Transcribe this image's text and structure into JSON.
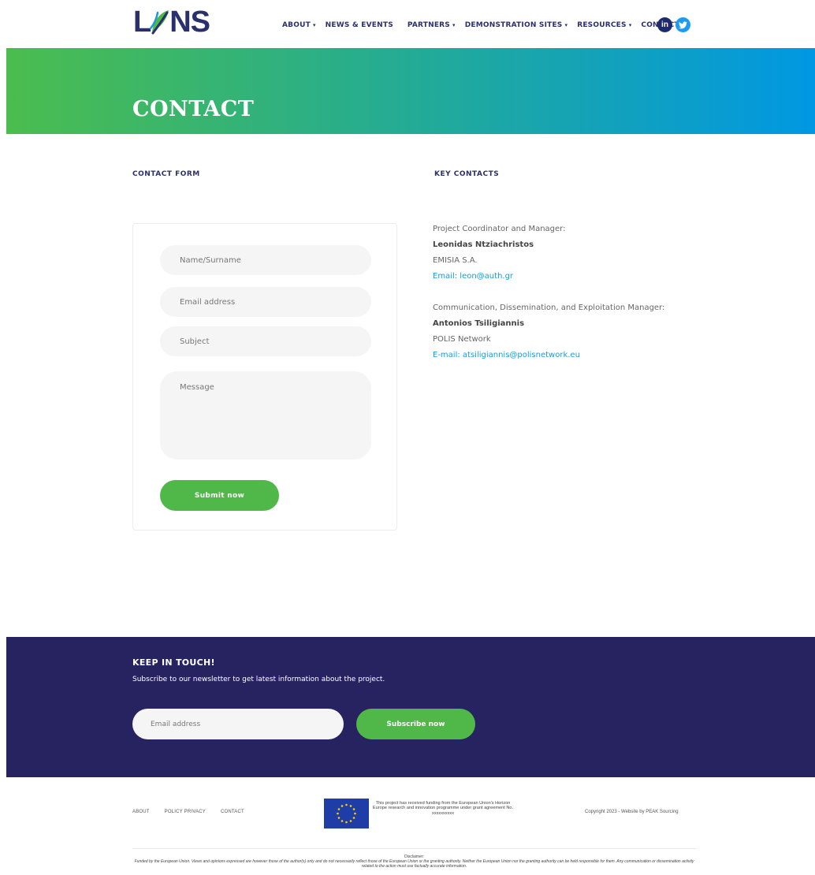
{
  "header": {
    "logo_text_left": "L",
    "logo_text_right": "NS",
    "nav": [
      {
        "label": "ABOUT",
        "dropdown": true
      },
      {
        "label": "NEWS & EVENTS",
        "dropdown": false
      },
      {
        "label": "PARTNERS",
        "dropdown": true
      },
      {
        "label": "DEMONSTRATION SITES",
        "dropdown": true
      },
      {
        "label": "RESOURCES",
        "dropdown": true
      },
      {
        "label": "CONTACT",
        "dropdown": false
      }
    ],
    "social": {
      "linkedin": "in",
      "twitter_icon": "twitter-bird-icon"
    }
  },
  "banner": {
    "title": "CONTACT"
  },
  "contact_form": {
    "heading": "CONTACT FORM",
    "name_placeholder": "Name/Surname",
    "email_placeholder": "Email address",
    "subject_placeholder": "Subject",
    "message_placeholder": "Message",
    "submit_label": "Submit now"
  },
  "key_contacts": {
    "heading": "KEY CONTACTS",
    "contacts": [
      {
        "role": "Project Coordinator and Manager:",
        "name": "Leonidas Ntziachristos",
        "org": "EMISIA S.A.",
        "email_label": "Email: leon@auth.gr"
      },
      {
        "role": "Communication, Dissemination, and Exploitation Manager:",
        "name": "Antonios Tsiligiannis",
        "org": "POLIS Network",
        "email_label": "E-mail: atsiligiannis@polisnetwork.eu"
      }
    ]
  },
  "newsletter": {
    "title": "KEEP IN TOUCH!",
    "description": "Subscribe to our newsletter to get latest information about the project.",
    "email_placeholder": "Email address",
    "button_label": "Subscribe now"
  },
  "footer": {
    "links": [
      "ABOUT",
      "POLICY PRIVACY",
      "CONTACT"
    ],
    "eu_text": "This project has received funding from the European Union's Horizon Europe research and innovation programme under grant agreement No. xxxxxxxxxx",
    "copyright": "Copyright 2023 - Website by PEAK Sourcing",
    "disclaimer_title": "Disclaimer:",
    "disclaimer_text": "Funded by the European Union. Views and opinions expressed are however those of the author(s) only and do not necessarily reflect those of the European Union or the granting authority. Neither the European Union nor the granting authority can be held responsible for them. Any communication or dissemination activity related to the action must use factually accurate information."
  },
  "colors": {
    "brand_navy": "#2a2f6e",
    "accent_green": "#4fb848",
    "link_blue": "#1c9bd7",
    "footer_navy": "#272360"
  }
}
